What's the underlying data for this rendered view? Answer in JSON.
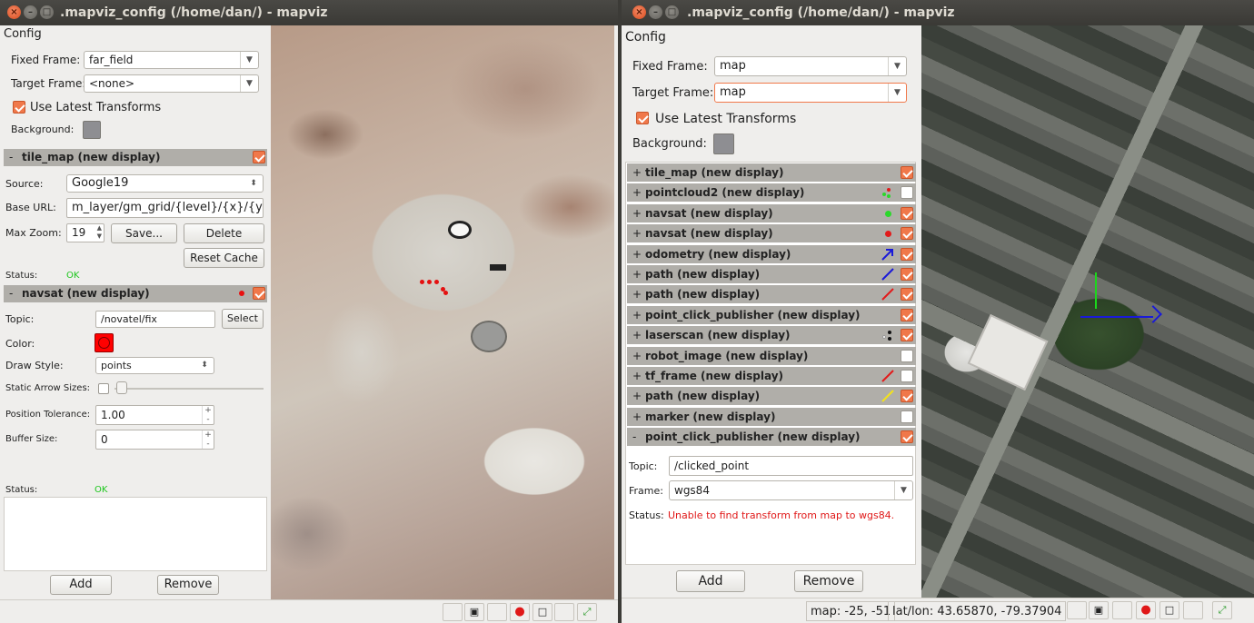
{
  "left": {
    "title": ".mapviz_config (/home/dan/) - mapviz",
    "config_label": "Config",
    "fixed_frame_label": "Fixed Frame:",
    "fixed_frame": "far_field",
    "target_frame_label": "Target Frame:",
    "target_frame": "<none>",
    "use_latest_label": "Use Latest Transforms",
    "background_label": "Background:",
    "tile_map": {
      "header": "tile_map (new display)",
      "source_label": "Source:",
      "source": "Google19",
      "base_url_label": "Base URL:",
      "base_url": "m_layer/gm_grid/{level}/{x}/{y}.png",
      "max_zoom_label": "Max Zoom:",
      "max_zoom": "19",
      "save": "Save...",
      "delete": "Delete",
      "reset_cache": "Reset Cache",
      "status_label": "Status:",
      "status": "OK"
    },
    "navsat": {
      "header": "navsat (new display)",
      "topic_label": "Topic:",
      "topic": "/novatel/fix",
      "select": "Select",
      "color_label": "Color:",
      "draw_style_label": "Draw Style:",
      "draw_style": "points",
      "static_arrow_label": "Static Arrow Sizes:",
      "position_tolerance_label": "Position Tolerance:",
      "position_tolerance": "1.00",
      "buffer_size_label": "Buffer Size:",
      "buffer_size": "0",
      "status_label": "Status:",
      "status": "OK"
    },
    "add": "Add",
    "remove": "Remove"
  },
  "right": {
    "title": ".mapviz_config (/home/dan/) - mapviz",
    "config_label": "Config",
    "fixed_frame_label": "Fixed Frame:",
    "fixed_frame": "map",
    "target_frame_label": "Target Frame:",
    "target_frame": "map",
    "use_latest_label": "Use Latest Transforms",
    "background_label": "Background:",
    "displays": [
      {
        "pm": "+",
        "name": "tile_map (new display)",
        "checked": true,
        "icon": "none"
      },
      {
        "pm": "+",
        "name": "pointcloud2 (new display)",
        "checked": false,
        "icon": "dots-multicolor-icon"
      },
      {
        "pm": "+",
        "name": "navsat (new display)",
        "checked": true,
        "icon": "green-dot-icon"
      },
      {
        "pm": "+",
        "name": "navsat (new display)",
        "checked": true,
        "icon": "red-dot-icon"
      },
      {
        "pm": "+",
        "name": "odometry (new display)",
        "checked": true,
        "icon": "blue-arrow-icon"
      },
      {
        "pm": "+",
        "name": "path (new display)",
        "checked": true,
        "icon": "blue-line-icon"
      },
      {
        "pm": "+",
        "name": "path (new display)",
        "checked": true,
        "icon": "red-line-icon"
      },
      {
        "pm": "+",
        "name": "point_click_publisher (new display)",
        "checked": true,
        "icon": "none"
      },
      {
        "pm": "+",
        "name": "laserscan (new display)",
        "checked": true,
        "icon": "dots-bw-icon"
      },
      {
        "pm": "+",
        "name": "robot_image (new display)",
        "checked": false,
        "icon": "none"
      },
      {
        "pm": "+",
        "name": "tf_frame (new display)",
        "checked": false,
        "icon": "red-line-icon"
      },
      {
        "pm": "+",
        "name": "path (new display)",
        "checked": true,
        "icon": "yellow-line-icon"
      },
      {
        "pm": "+",
        "name": "marker (new display)",
        "checked": false,
        "icon": "none"
      },
      {
        "pm": "-",
        "name": "point_click_publisher (new display)",
        "checked": true,
        "icon": "none"
      }
    ],
    "pcp": {
      "topic_label": "Topic:",
      "topic": "/clicked_point",
      "frame_label": "Frame:",
      "frame": "wgs84",
      "status_label": "Status:",
      "status": "Unable to find transform from map to wgs84."
    },
    "add": "Add",
    "remove": "Remove",
    "status_map": "map: -25, -51",
    "status_latlon": "lat/lon: 43.65870, -79.37904"
  },
  "colors": {
    "accent": "#f0784a",
    "background_swatch": "#8e8e92",
    "navsat_color": "#ff0000",
    "ok": "#1ec71e",
    "error": "#e01818"
  }
}
